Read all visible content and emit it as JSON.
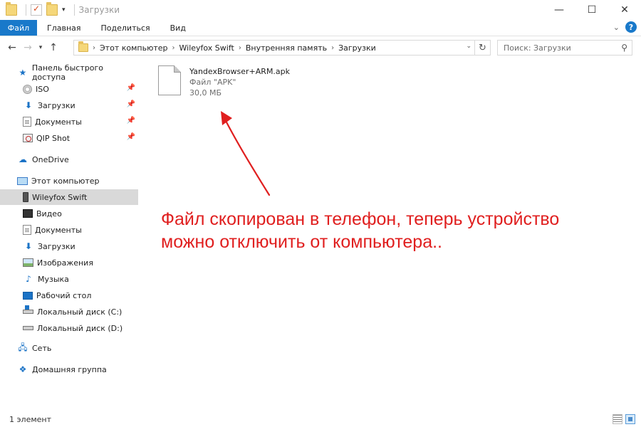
{
  "window": {
    "title": "Загрузки",
    "controls": {
      "minimize": "—",
      "maximize": "☐",
      "close": "✕"
    }
  },
  "ribbon": {
    "tabs": [
      "Файл",
      "Главная",
      "Поделиться",
      "Вид"
    ]
  },
  "address": {
    "crumbs": [
      "Этот компьютер",
      "Wileyfox Swift",
      "Внутренняя память",
      "Загрузки"
    ]
  },
  "search": {
    "placeholder": "Поиск: Загрузки"
  },
  "sidebar": {
    "quick_access": "Панель быстрого доступа",
    "quick_items": [
      "ISO",
      "Загрузки",
      "Документы",
      "QIP Shot"
    ],
    "onedrive": "OneDrive",
    "this_pc": "Этот компьютер",
    "pc_items": [
      "Wileyfox Swift",
      "Видео",
      "Документы",
      "Загрузки",
      "Изображения",
      "Музыка",
      "Рабочий стол",
      "Локальный диск (C:)",
      "Локальный диск (D:)"
    ],
    "network": "Сеть",
    "homegroup": "Домашняя группа"
  },
  "file": {
    "name": "YandexBrowser+ARM.apk",
    "type": "Файл \"APK\"",
    "size": "30,0 МБ"
  },
  "annotation": {
    "line1": "Файл скопирован в телефон, теперь устройство",
    "line2": "можно отключить от компьютера.."
  },
  "status": {
    "count": "1 элемент"
  },
  "colors": {
    "accent": "#1979ca",
    "annotation": "#e01f1f",
    "selected": "#d9d9d9"
  }
}
